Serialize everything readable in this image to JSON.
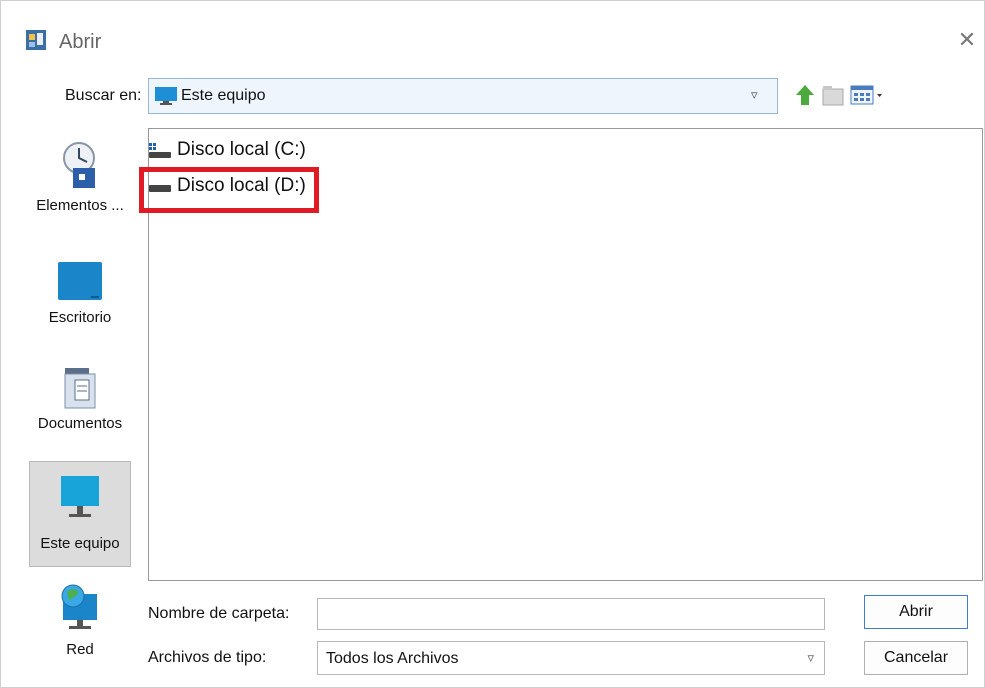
{
  "window": {
    "title": "Abrir"
  },
  "toolbar": {
    "lookin_label": "Buscar en:",
    "lookin_value": "Este equipo"
  },
  "places": [
    {
      "label": "Elementos ..."
    },
    {
      "label": "Escritorio"
    },
    {
      "label": "Documentos"
    },
    {
      "label": "Este equipo",
      "selected": true
    },
    {
      "label": "Red"
    }
  ],
  "files": [
    {
      "name": "Disco local (C:)",
      "icon": "system-drive-icon"
    },
    {
      "name": "Disco local (D:)",
      "icon": "drive-icon",
      "highlighted": true
    }
  ],
  "form": {
    "folder_label": "Nombre de carpeta:",
    "folder_value": "",
    "type_label": "Archivos de tipo:",
    "type_value": "Todos los Archivos"
  },
  "buttons": {
    "open": "Abrir",
    "cancel": "Cancelar"
  },
  "colors": {
    "highlight": "#e01b24",
    "accent": "#3c7fd4"
  }
}
